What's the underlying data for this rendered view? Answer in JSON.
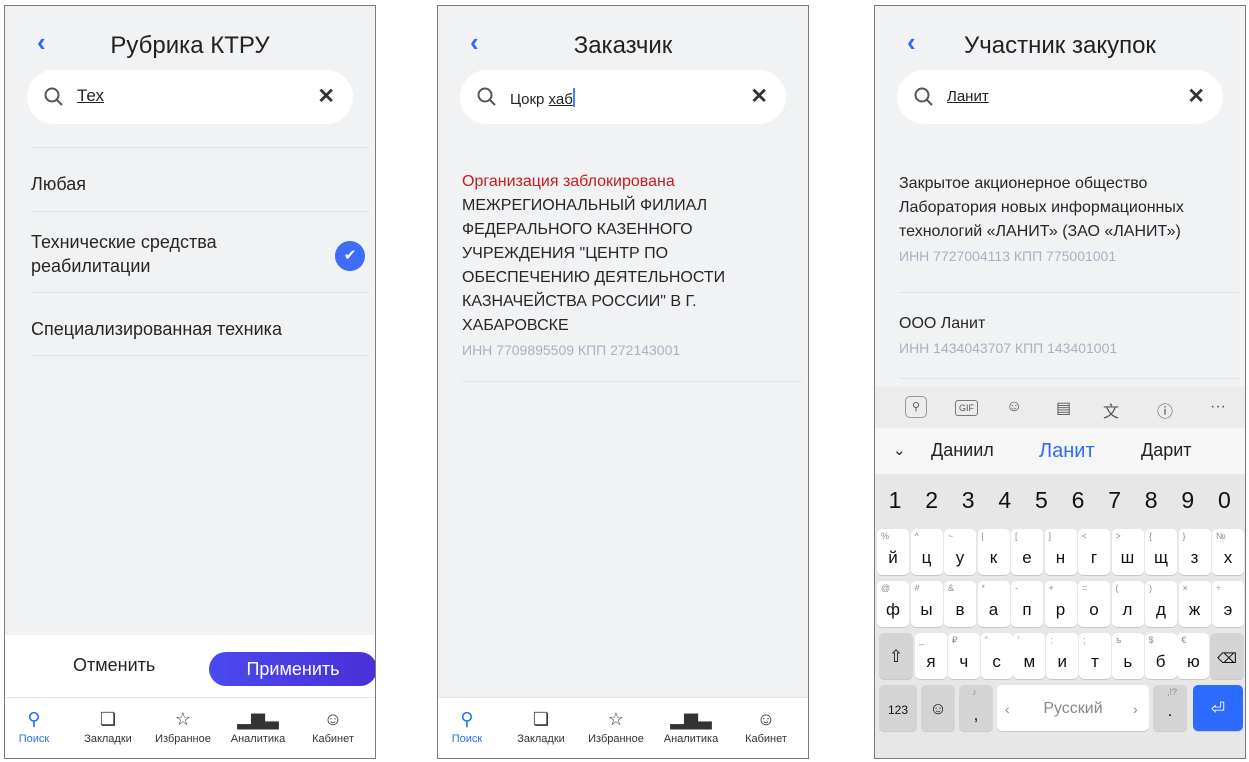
{
  "screen1": {
    "title": "Рубрика КТРУ",
    "search_value": "Тех",
    "options": [
      "Любая",
      "Технические средства реабилитации",
      "Специализированная техника"
    ],
    "cancel_label": "Отменить",
    "apply_label": "Применить"
  },
  "screen2": {
    "title": "Заказчик",
    "search_value_prefix": "Цокр ",
    "search_value_underlined": "хаб",
    "status": "Организация заблокирована",
    "org_name": "МЕЖРЕГИОНАЛЬНЫЙ ФИЛИАЛ ФЕДЕРАЛЬНОГО КАЗЕННОГО УЧРЕЖДЕНИЯ \"ЦЕНТР ПО ОБЕСПЕЧЕНИЮ ДЕЯТЕЛЬНОСТИ КАЗНАЧЕЙСТВА РОССИИ\" В Г. ХАБАРОВСКЕ",
    "org_meta": "ИНН 7709895509 КПП 272143001"
  },
  "screen3": {
    "title": "Участник закупок",
    "search_value": "Ланит",
    "results": [
      {
        "name": "Закрытое акционерное общество Лаборатория новых информационных технологий «ЛАНИТ» (ЗАО «ЛАНИТ»)",
        "meta": "ИНН 7727004113 КПП 775001001"
      },
      {
        "name": "ООО Ланит",
        "meta": "ИНН 1434043707 КПП 143401001"
      }
    ],
    "suggestions": [
      "Даниил",
      "Ланит",
      "Дарит"
    ],
    "space_label": "Русский",
    "mode_label": "123"
  },
  "tabs": [
    "Поиск",
    "Закладки",
    "Избранное",
    "Аналитика",
    "Кабинет"
  ],
  "keyboard": {
    "numbers": [
      "1",
      "2",
      "3",
      "4",
      "5",
      "6",
      "7",
      "8",
      "9",
      "0"
    ],
    "row1": [
      [
        "%",
        "й"
      ],
      [
        "^",
        "ц"
      ],
      [
        "~",
        "у"
      ],
      [
        "|",
        "к"
      ],
      [
        "[",
        "е"
      ],
      [
        "]",
        "н"
      ],
      [
        "<",
        "г"
      ],
      [
        ">",
        "ш"
      ],
      [
        "{",
        "щ"
      ],
      [
        "}",
        "з"
      ],
      [
        "№",
        "х"
      ]
    ],
    "row2": [
      [
        "@",
        "ф"
      ],
      [
        "#",
        "ы"
      ],
      [
        "&",
        "в"
      ],
      [
        "*",
        "а"
      ],
      [
        "-",
        "п"
      ],
      [
        "+",
        "р"
      ],
      [
        "=",
        "о"
      ],
      [
        "(",
        "л"
      ],
      [
        ")",
        "д"
      ],
      [
        "×",
        "ж"
      ],
      [
        "÷",
        "э"
      ]
    ],
    "row3": [
      [
        "_",
        "я"
      ],
      [
        "₽",
        "ч"
      ],
      [
        "\"",
        "с"
      ],
      [
        "'",
        "м"
      ],
      [
        ":",
        "и"
      ],
      [
        ";",
        "т"
      ],
      [
        "ъ",
        "ь"
      ],
      [
        "$",
        "б"
      ],
      [
        "€",
        "ю"
      ]
    ]
  },
  "colors": {
    "accent": "#2d6bff",
    "blocked": "#c71b1b",
    "meta": "#a9b1c0"
  }
}
